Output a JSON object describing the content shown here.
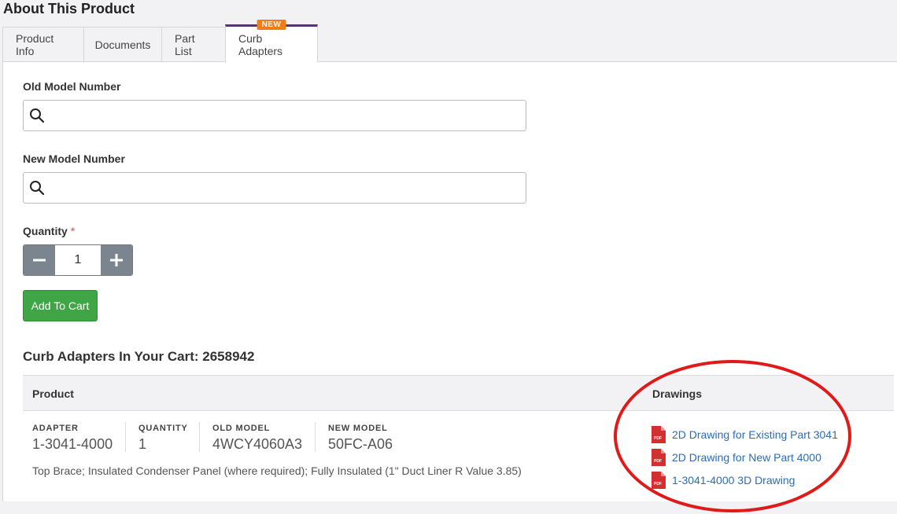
{
  "page": {
    "title": "About This Product"
  },
  "tabs": [
    {
      "label": "Product Info"
    },
    {
      "label": "Documents"
    },
    {
      "label": "Part List"
    },
    {
      "label": "Curb Adapters",
      "badge": "NEW"
    }
  ],
  "form": {
    "old_model_label": "Old Model Number",
    "old_model_value": "",
    "new_model_label": "New Model Number",
    "new_model_value": "",
    "quantity_label": "Quantity",
    "required_mark": "*",
    "quantity_value": "1",
    "add_to_cart_label": "Add To Cart"
  },
  "cart": {
    "title": "Curb Adapters In Your Cart: 2658942",
    "headers": {
      "product": "Product",
      "drawings": "Drawings"
    },
    "item": {
      "adapter_label": "ADAPTER",
      "adapter_value": "1-3041-4000",
      "quantity_label": "QUANTITY",
      "quantity_value": "1",
      "old_model_label": "OLD MODEL",
      "old_model_value": "4WCY4060A3",
      "new_model_label": "NEW MODEL",
      "new_model_value": "50FC-A06",
      "description": "Top Brace; Insulated Condenser Panel (where required); Fully Insulated (1\" Duct Liner R Value 3.85)",
      "drawings": [
        {
          "label": "2D Drawing for Existing Part 3041",
          "icon": "pdf-icon"
        },
        {
          "label": "2D Drawing for New Part 4000",
          "icon": "pdf-icon"
        },
        {
          "label": "1-3041-4000 3D Drawing",
          "icon": "pdf-icon"
        }
      ]
    }
  },
  "colors": {
    "accent_tab": "#5a2e82",
    "badge": "#f07d1a",
    "cart_button": "#3fa545",
    "link": "#2a6db8",
    "highlight": "#e01919",
    "pdf": "#d32f2f"
  },
  "icons": {
    "search": "search-icon",
    "minus": "minus-icon",
    "plus": "plus-icon",
    "pdf": "pdf-icon"
  }
}
